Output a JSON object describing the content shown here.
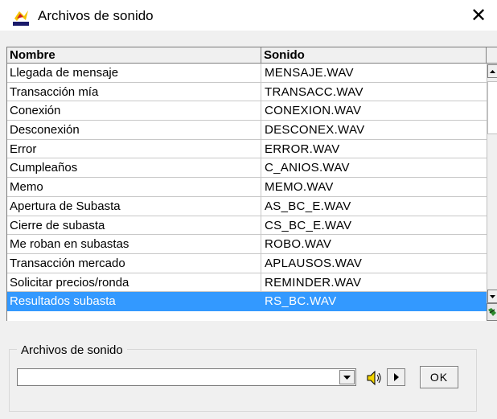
{
  "window": {
    "title": "Archivos de sonido",
    "close_glyph": "✕"
  },
  "table": {
    "columns": [
      "Nombre",
      "Sonido"
    ],
    "rows": [
      {
        "name": "Llegada de mensaje",
        "sound": "MENSAJE.WAV"
      },
      {
        "name": "Transacción mía",
        "sound": "TRANSACC.WAV"
      },
      {
        "name": "Conexión",
        "sound": "CONEXION.WAV"
      },
      {
        "name": "Desconexión",
        "sound": "DESCONEX.WAV"
      },
      {
        "name": "Error",
        "sound": "ERROR.WAV"
      },
      {
        "name": "Cumpleaños",
        "sound": "C_ANIOS.WAV"
      },
      {
        "name": "Memo",
        "sound": "MEMO.WAV"
      },
      {
        "name": "Apertura de Subasta",
        "sound": "AS_BC_E.WAV"
      },
      {
        "name": "Cierre de subasta",
        "sound": "CS_BC_E.WAV"
      },
      {
        "name": "Me roban en subastas",
        "sound": "ROBO.WAV"
      },
      {
        "name": "Transacción mercado",
        "sound": "APLAUSOS.WAV"
      },
      {
        "name": "Solicitar precios/ronda",
        "sound": "REMINDER.WAV"
      },
      {
        "name": "Resultados subasta",
        "sound": "RS_BC.WAV"
      }
    ],
    "selected_index": 12
  },
  "sound_files": {
    "group_label": "Archivos de sonido",
    "selected_value": "",
    "ok_label": "OK"
  },
  "icons": {
    "app": "app-logo-icon",
    "close": "close-icon",
    "scroll_up": "scroll-up-arrow-icon",
    "scroll_down": "scroll-down-arrow-icon",
    "row_editor": "row-editor-icon",
    "dropdown": "dropdown-arrow-icon",
    "speaker": "speaker-icon",
    "play": "play-icon"
  },
  "colors": {
    "selection": "#3399ff",
    "dialog_bg": "#f0f0f0"
  }
}
